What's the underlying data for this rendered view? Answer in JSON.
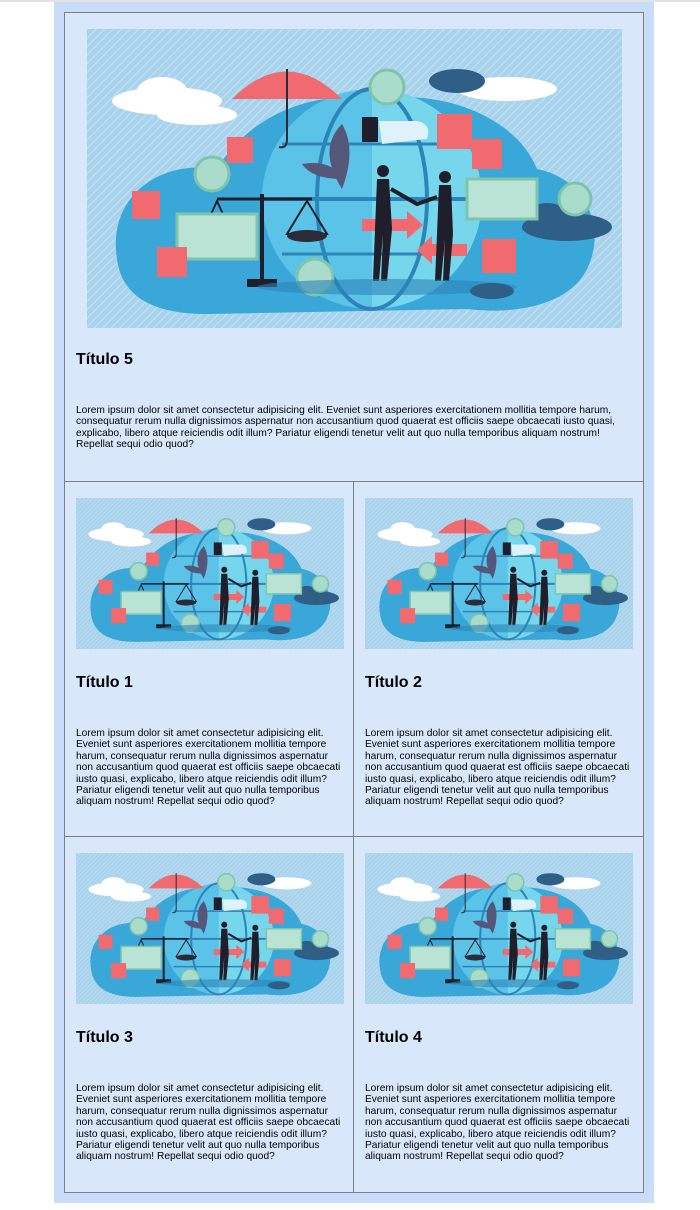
{
  "featured": {
    "title": "Título 5",
    "text": "Lorem ipsum dolor sit amet consectetur adipisicing elit. Eveniet sunt asperiores exercitationem mollitia tempore harum, consequatur rerum nulla dignissimos aspernatur non accusantium quod quaerat est officiis saepe obcaecati iusto quasi, explicabo, libero atque reiciendis odit illum? Pariatur eligendi tenetur velit aut quo nulla temporibus aliquam nostrum! Repellat sequi odio quod?"
  },
  "cards": [
    {
      "title": "Título 1",
      "text": "Lorem ipsum dolor sit amet consectetur adipisicing elit. Eveniet sunt asperiores exercitationem mollitia tempore harum, consequatur rerum nulla dignissimos aspernatur non accusantium quod quaerat est officiis saepe obcaecati iusto quasi, explicabo, libero atque reiciendis odit illum? Pariatur eligendi tenetur velit aut quo nulla temporibus aliquam nostrum! Repellat sequi odio quod?"
    },
    {
      "title": "Título 2",
      "text": "Lorem ipsum dolor sit amet consectetur adipisicing elit. Eveniet sunt asperiores exercitationem mollitia tempore harum, consequatur rerum nulla dignissimos aspernatur non accusantium quod quaerat est officiis saepe obcaecati iusto quasi, explicabo, libero atque reiciendis odit illum? Pariatur eligendi tenetur velit aut quo nulla temporibus aliquam nostrum! Repellat sequi odio quod?"
    },
    {
      "title": "Título 3",
      "text": "Lorem ipsum dolor sit amet consectetur adipisicing elit. Eveniet sunt asperiores exercitationem mollitia tempore harum, consequatur rerum nulla dignissimos aspernatur non accusantium quod quaerat est officiis saepe obcaecati iusto quasi, explicabo, libero atque reiciendis odit illum? Pariatur eligendi tenetur velit aut quo nulla temporibus aliquam nostrum! Repellat sequi odio quod?"
    },
    {
      "title": "Título 4",
      "text": "Lorem ipsum dolor sit amet consectetur adipisicing elit. Eveniet sunt asperiores exercitationem mollitia tempore harum, consequatur rerum nulla dignissimos aspernatur non accusantium quod quaerat est officiis saepe obcaecati iusto quasi, explicabo, libero atque reiciendis odit illum? Pariatur eligendi tenetur velit aut quo nulla temporibus aliquam nostrum! Repellat sequi odio quod?"
    }
  ],
  "colors": {
    "page_background": "#c9ddfb",
    "card_background": "#d9e7fb",
    "card_border": "#7f7f7f",
    "illustration_sky": "#a9d3ec",
    "illustration_globe": "#3aa7d9",
    "illustration_accent": "#f16a6f"
  },
  "illustration": {
    "icon": "business-scales-globe-handshake-illustration"
  }
}
